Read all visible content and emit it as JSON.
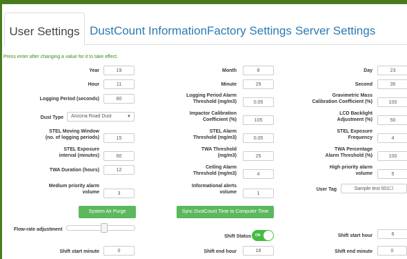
{
  "tabs": [
    "User Settings",
    "DustCount Information",
    "Factory Settings",
    "Server Settings"
  ],
  "notice": "Press enter after changing a value for it to take effect.",
  "fields": {
    "year": {
      "label": "Year",
      "value": "19"
    },
    "month": {
      "label": "Month",
      "value": "8"
    },
    "day": {
      "label": "Day",
      "value": "23"
    },
    "hour": {
      "label": "Hour",
      "value": "11"
    },
    "minute": {
      "label": "Minute",
      "value": "29"
    },
    "second": {
      "label": "Second",
      "value": "35"
    },
    "logging_period": {
      "label": "Logging Period (seconds)",
      "value": "60"
    },
    "logging_alarm": {
      "label1": "Logging Period Alarm",
      "label2": "Threshold (mg/m3)",
      "value": "0.05"
    },
    "grav_mass": {
      "label1": "Gravimetric Mass",
      "label2": "Calibration Coefficient (%)",
      "value": "100"
    },
    "dust_type": {
      "label": "Dust Type",
      "value": "Arizona Road Dust"
    },
    "impactor": {
      "label1": "Impactor Calibration",
      "label2": "Coefficient (%)",
      "value": "105"
    },
    "lcd_backlight": {
      "label1": "LCD Backlight",
      "label2": "Adjustment (%)",
      "value": "50"
    },
    "stel_window": {
      "label1": "STEL Moving Window",
      "label2": "(no. of logging periods)",
      "value": "15"
    },
    "stel_alarm": {
      "label1": "STEL Alarm",
      "label2": "Threshold (mg/m3)",
      "value": "0.05"
    },
    "stel_freq": {
      "label1": "STEL Exposure",
      "label2": "Frequency",
      "value": "4"
    },
    "stel_interval": {
      "label1": "STEL Exposure",
      "label2": "interval (minutes)",
      "value": "60"
    },
    "twa_threshold": {
      "label1": "TWA Threshold",
      "label2": "(mg/m3)",
      "value": "25"
    },
    "twa_pct": {
      "label1": "TWA Percentage",
      "label2": "Alarm Threshold (%)",
      "value": "100"
    },
    "twa_duration": {
      "label": "TWA Duration (hours)",
      "value": "12"
    },
    "ceiling_alarm": {
      "label1": "Ceiling Alarm",
      "label2": "Threshold (mg/m3)",
      "value": "4"
    },
    "high_alarm": {
      "label1": "High priority alarm",
      "label2": "volume",
      "value": "5"
    },
    "medium_alarm": {
      "label1": "Medium priority alarm",
      "label2": "volume",
      "value": "3"
    },
    "info_alerts": {
      "label1": "Informational alerts",
      "label2": "volume",
      "value": "1"
    },
    "user_tag": {
      "label": "User Tag",
      "value": "Sample test 001☐"
    },
    "shift_start_hour": {
      "label": "Shift start hour",
      "value": "6"
    },
    "shift_start_minute": {
      "label": "Shift start minute",
      "value": "0"
    },
    "shift_end_hour": {
      "label": "Shift end hour",
      "value": "18"
    },
    "shift_end_minute": {
      "label": "Shift end minute",
      "value": "0"
    }
  },
  "buttons": {
    "air_purge": "System Air Purge",
    "sync_time": "Sync DustCount Time to Computer Time"
  },
  "flow_rate": {
    "label": "Flow-rate adjustment",
    "level_percent": 55
  },
  "shift_status": {
    "label": "Shift Status",
    "state": "ON"
  },
  "colors": {
    "accent_green": "#5cb85c",
    "tab_link": "#2a7ab0",
    "top_bar": "#4a7a1e",
    "toggle_on": "#44bb44"
  }
}
